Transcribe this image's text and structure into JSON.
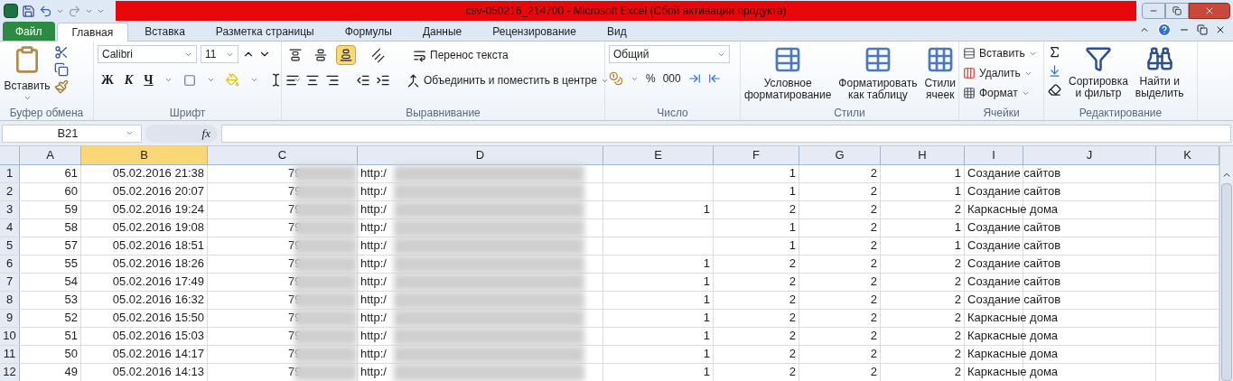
{
  "title_bar": {
    "title": "csv-050216_214700  -  Microsoft Excel (Сбой активации продукта)"
  },
  "tabs": [
    {
      "label": "Файл",
      "kind": "file",
      "selected": false
    },
    {
      "label": "Главная",
      "kind": "tab",
      "selected": true
    },
    {
      "label": "Вставка",
      "kind": "tab",
      "selected": false
    },
    {
      "label": "Разметка страницы",
      "kind": "tab",
      "selected": false
    },
    {
      "label": "Формулы",
      "kind": "tab",
      "selected": false
    },
    {
      "label": "Данные",
      "kind": "tab",
      "selected": false
    },
    {
      "label": "Рецензирование",
      "kind": "tab",
      "selected": false
    },
    {
      "label": "Вид",
      "kind": "tab",
      "selected": false
    }
  ],
  "ribbon": {
    "clipboard": {
      "paste": "Вставить",
      "label": "Буфер обмена"
    },
    "font": {
      "name": "Calibri",
      "size": "11",
      "bold": "Ж",
      "italic": "К",
      "underline": "Ч",
      "label": "Шрифт"
    },
    "alignment": {
      "vertical": [
        {
          "selected": false
        },
        {
          "selected": false
        },
        {
          "selected": true
        }
      ],
      "wrap": "Перенос текста",
      "merge": "Объединить и поместить в центре",
      "label": "Выравнивание"
    },
    "number": {
      "format": "Общий",
      "percent": "%",
      "thousands": "000",
      "label": "Число"
    },
    "styles": {
      "buttons": [
        {
          "lines": [
            "Условное",
            "форматирование"
          ],
          "kind": "conditional"
        },
        {
          "lines": [
            "Форматировать",
            "как таблицу"
          ],
          "kind": "table"
        },
        {
          "lines": [
            "Стили",
            "ячеек"
          ],
          "kind": "cellstyle"
        }
      ],
      "label": "Стили"
    },
    "cells": {
      "buttons": [
        {
          "label": "Вставить",
          "kind": "insert"
        },
        {
          "label": "Удалить",
          "kind": "delete"
        },
        {
          "label": "Формат",
          "kind": "format"
        }
      ],
      "label": "Ячейки"
    },
    "editing": {
      "buttons": [
        {
          "lines": [
            "Сортировка",
            "и фильтр"
          ],
          "kind": "sort"
        },
        {
          "lines": [
            "Найти и",
            "выделить"
          ],
          "kind": "find"
        }
      ],
      "label": "Редактирование"
    }
  },
  "formula_bar": {
    "name_box": "B21",
    "function_label": "fx"
  },
  "columns": [
    {
      "label": "A",
      "selected": false,
      "redacted": false
    },
    {
      "label": "B",
      "selected": true,
      "redacted": false
    },
    {
      "label": "C",
      "selected": false,
      "redacted": true
    },
    {
      "label": "D",
      "selected": false,
      "redacted": true
    },
    {
      "label": "E",
      "selected": false,
      "redacted": false
    },
    {
      "label": "F",
      "selected": false,
      "redacted": false
    },
    {
      "label": "G",
      "selected": false,
      "redacted": false
    },
    {
      "label": "H",
      "selected": false,
      "redacted": false
    },
    {
      "label": "I",
      "selected": false,
      "redacted": false
    },
    {
      "label": "J",
      "selected": false,
      "redacted": false
    },
    {
      "label": "K",
      "selected": false,
      "redacted": false
    }
  ],
  "rows": [
    {
      "number": "1",
      "cells": [
        "61",
        "05.02.2016 21:38",
        "79",
        "http:/",
        "",
        "1",
        "2",
        "1",
        "Создание сайтов",
        "",
        ""
      ]
    },
    {
      "number": "2",
      "cells": [
        "60",
        "05.02.2016 20:07",
        "79",
        "http:/",
        "",
        "1",
        "2",
        "1",
        "Создание сайтов",
        "",
        ""
      ]
    },
    {
      "number": "3",
      "cells": [
        "59",
        "05.02.2016 19:24",
        "79",
        "http:/",
        "1",
        "2",
        "2",
        "2",
        "Каркасные дома",
        "",
        ""
      ]
    },
    {
      "number": "4",
      "cells": [
        "58",
        "05.02.2016 19:08",
        "79",
        "http:/",
        "",
        "1",
        "2",
        "1",
        "Создание сайтов",
        "",
        ""
      ]
    },
    {
      "number": "5",
      "cells": [
        "57",
        "05.02.2016 18:51",
        "79",
        "http:/",
        "",
        "1",
        "2",
        "1",
        "Создание сайтов",
        "",
        ""
      ]
    },
    {
      "number": "6",
      "cells": [
        "55",
        "05.02.2016 18:26",
        "79",
        "http:/",
        "1",
        "2",
        "2",
        "2",
        "Создание сайтов",
        "",
        ""
      ]
    },
    {
      "number": "7",
      "cells": [
        "54",
        "05.02.2016 17:49",
        "79",
        "http:/",
        "1",
        "2",
        "2",
        "2",
        "Создание сайтов",
        "",
        ""
      ]
    },
    {
      "number": "8",
      "cells": [
        "53",
        "05.02.2016 16:32",
        "79",
        "http:/",
        "1",
        "2",
        "2",
        "2",
        "Создание сайтов",
        "",
        ""
      ]
    },
    {
      "number": "9",
      "cells": [
        "52",
        "05.02.2016 15:50",
        "79",
        "http:/",
        "1",
        "2",
        "2",
        "2",
        "Каркасные дома",
        "",
        ""
      ]
    },
    {
      "number": "10",
      "cells": [
        "51",
        "05.02.2016 15:03",
        "79",
        "http:/",
        "1",
        "2",
        "2",
        "2",
        "Каркасные дома",
        "",
        ""
      ]
    },
    {
      "number": "11",
      "cells": [
        "50",
        "05.02.2016 14:17",
        "79",
        "http:/",
        "1",
        "2",
        "2",
        "2",
        "Каркасные дома",
        "",
        ""
      ]
    },
    {
      "number": "12",
      "cells": [
        "49",
        "05.02.2016 14:13",
        "79",
        "http:/",
        "1",
        "2",
        "2",
        "2",
        "Каркасные дома",
        "",
        ""
      ]
    }
  ]
}
